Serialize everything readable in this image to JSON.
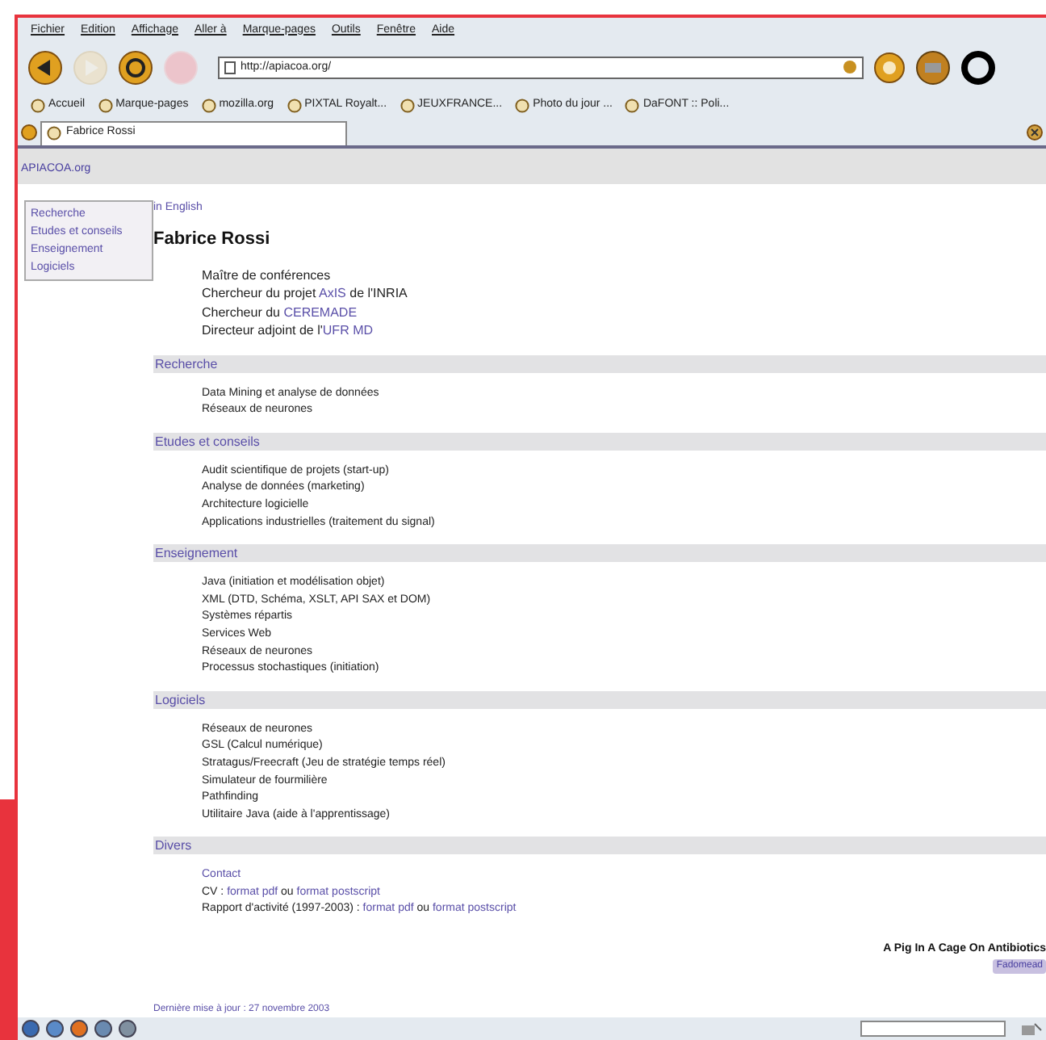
{
  "menu": [
    "Fichier",
    "Edition",
    "Affichage",
    "Aller à",
    "Marque-pages",
    "Outils",
    "Fenêtre",
    "Aide"
  ],
  "toolbar": {
    "buttons": [
      {
        "kind": "back",
        "disabled": false
      },
      {
        "kind": "forward",
        "disabled": true
      },
      {
        "kind": "reload",
        "disabled": false
      },
      {
        "kind": "stop",
        "disabled": true
      }
    ],
    "address": "http://apiacoa.org/"
  },
  "bookmarks": [
    "Accueil",
    "Marque-pages",
    "mozilla.org",
    "PIXTAL Royalt...",
    "JEUXFRANCE...",
    "Photo du jour ...",
    "DaFONT :: Poli..."
  ],
  "tabs": [
    {
      "label": "Fabrice Rossi",
      "selected": true
    }
  ],
  "site_bar": {
    "title": "APIACOA.org"
  },
  "sidebar": {
    "items": [
      "Recherche",
      "Etudes et conseils",
      "Enseignement",
      "Logiciels"
    ]
  },
  "page": {
    "language_link": "in English",
    "heading": "Fabrice Rossi",
    "intro": [
      [
        {
          "text": "Maître de conférences",
          "kind": "text"
        }
      ],
      [
        {
          "text": "Chercheur du projet ",
          "kind": "text"
        },
        {
          "text": "AxIS",
          "kind": "link"
        },
        {
          "text": " de l'INRIA",
          "kind": "text"
        }
      ],
      [
        {
          "text": "Chercheur du ",
          "kind": "text"
        },
        {
          "text": "CEREMADE",
          "kind": "link"
        }
      ],
      [
        {
          "text": "Directeur adjoint de l'",
          "kind": "text"
        },
        {
          "text": "UFR MD",
          "kind": "link"
        }
      ]
    ],
    "sections": [
      {
        "title": "Recherche",
        "items": [
          [
            {
              "text": "Data Mining et analyse de données",
              "kind": "text"
            }
          ],
          [
            {
              "text": "Réseaux de neurones",
              "kind": "text"
            }
          ]
        ]
      },
      {
        "title": "Etudes et conseils",
        "items": [
          [
            {
              "text": "Audit scientifique de projets (start-up)",
              "kind": "text"
            }
          ],
          [
            {
              "text": "Analyse de données (marketing)",
              "kind": "text"
            }
          ],
          [
            {
              "text": "Architecture logicielle",
              "kind": "text"
            }
          ],
          [
            {
              "text": "Applications industrielles (traitement du signal)",
              "kind": "text"
            }
          ]
        ]
      },
      {
        "title": "Enseignement",
        "items": [
          [
            {
              "text": "Java (initiation et modélisation objet)",
              "kind": "text"
            }
          ],
          [
            {
              "text": "XML (DTD, Schéma, XSLT, API SAX et DOM)",
              "kind": "text"
            }
          ],
          [
            {
              "text": "Systèmes répartis",
              "kind": "text"
            }
          ],
          [
            {
              "text": "Services Web",
              "kind": "text"
            }
          ],
          [
            {
              "text": "Réseaux de neurones",
              "kind": "text"
            }
          ],
          [
            {
              "text": "Processus stochastiques (initiation)",
              "kind": "text"
            }
          ]
        ]
      },
      {
        "title": "Logiciels",
        "items": [
          [
            {
              "text": "Réseaux de neurones",
              "kind": "text"
            }
          ],
          [
            {
              "text": "GSL (Calcul numérique)",
              "kind": "text"
            }
          ],
          [
            {
              "text": "Stratagus/Freecraft (Jeu de stratégie temps réel)",
              "kind": "text"
            }
          ],
          [
            {
              "text": "Simulateur de fourmilière",
              "kind": "text"
            }
          ],
          [
            {
              "text": "Pathfinding",
              "kind": "text"
            }
          ],
          [
            {
              "text": "Utilitaire Java (aide à l'apprentissage)",
              "kind": "text"
            }
          ]
        ]
      },
      {
        "title": "Divers",
        "items": [
          [
            {
              "text": "Contact",
              "kind": "link"
            }
          ],
          [
            {
              "text": "CV : ",
              "kind": "text"
            },
            {
              "text": "format pdf",
              "kind": "link"
            },
            {
              "text": " ou ",
              "kind": "text"
            },
            {
              "text": "format postscript",
              "kind": "link"
            }
          ],
          [
            {
              "text": "Rapport d'activité (1997-2003) : ",
              "kind": "text"
            },
            {
              "text": "format pdf",
              "kind": "link"
            },
            {
              "text": " ou ",
              "kind": "text"
            },
            {
              "text": "format postscript",
              "kind": "link"
            }
          ]
        ]
      }
    ],
    "last_update": "Dernière mise à jour : 27 novembre 2003"
  },
  "banner": {
    "title": "A Pig In A Cage On Antibiotics",
    "badge": "Fadomead"
  }
}
